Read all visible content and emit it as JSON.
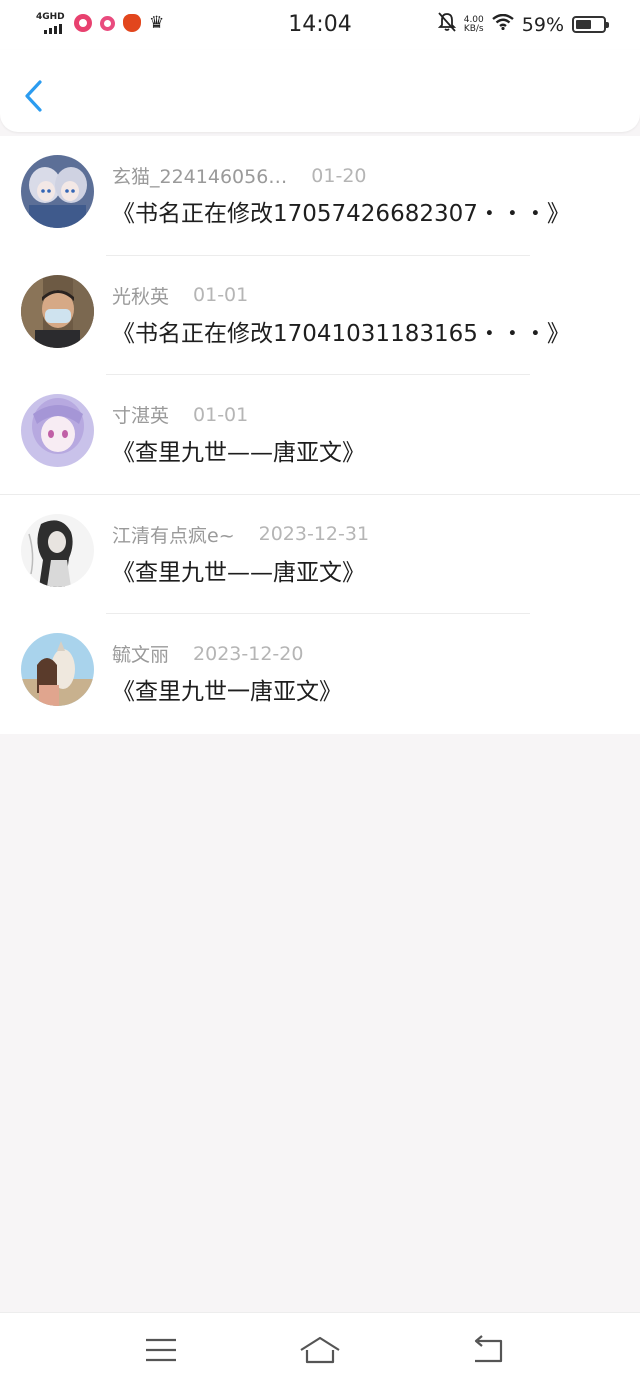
{
  "status_bar": {
    "network": "4GHD",
    "time": "14:04",
    "speed_value": "4.00",
    "speed_unit": "KB/s",
    "battery": "59%",
    "battery_level": 0.59
  },
  "header": {
    "back_icon": "chevron-left-icon"
  },
  "colors": {
    "accent": "#2b9cf0",
    "meta_text": "#9a9a9a",
    "title_text": "#1e1e1e"
  },
  "items": [
    {
      "name": "玄猫_224146056…",
      "date": "01-20",
      "title": "《书名正在修改17057426682307・・・》"
    },
    {
      "name": "光秋英",
      "date": "01-01",
      "title": "《书名正在修改17041031183165・・・》"
    },
    {
      "name": "寸湛英",
      "date": "01-01",
      "title": "《查里九世——唐亚文》"
    },
    {
      "name": "江清有点疯e~",
      "date": "2023-12-31",
      "title": "《查里九世——唐亚文》"
    },
    {
      "name": "毓文丽",
      "date": "2023-12-20",
      "title": "《查里九世一唐亚文》"
    }
  ],
  "bottom_nav": {
    "menu_icon": "menu-icon",
    "home_icon": "home-icon",
    "back_icon": "back-icon"
  }
}
